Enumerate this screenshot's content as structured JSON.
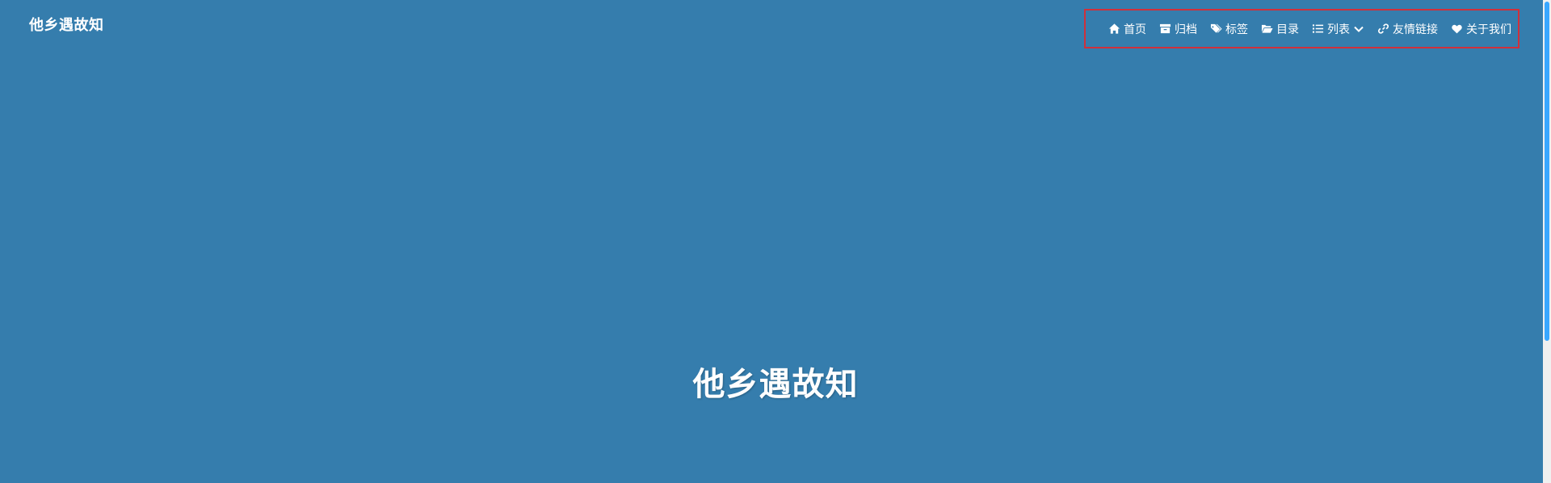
{
  "site": {
    "brand": "他乡遇故知",
    "hero_title": "他乡遇故知"
  },
  "nav": {
    "items": [
      {
        "label": "首页",
        "icon": "home-icon"
      },
      {
        "label": "归档",
        "icon": "archive-icon"
      },
      {
        "label": "标签",
        "icon": "tags-icon"
      },
      {
        "label": "目录",
        "icon": "folder-open-icon"
      },
      {
        "label": "列表",
        "icon": "list-icon",
        "has_dropdown": true
      },
      {
        "label": "友情链接",
        "icon": "link-icon"
      },
      {
        "label": "关于我们",
        "icon": "heart-icon"
      }
    ]
  },
  "colors": {
    "background": "#357dad",
    "text": "#ffffff",
    "highlight_border": "#d0303b",
    "scrollbar_thumb": "#3aa7ff"
  }
}
